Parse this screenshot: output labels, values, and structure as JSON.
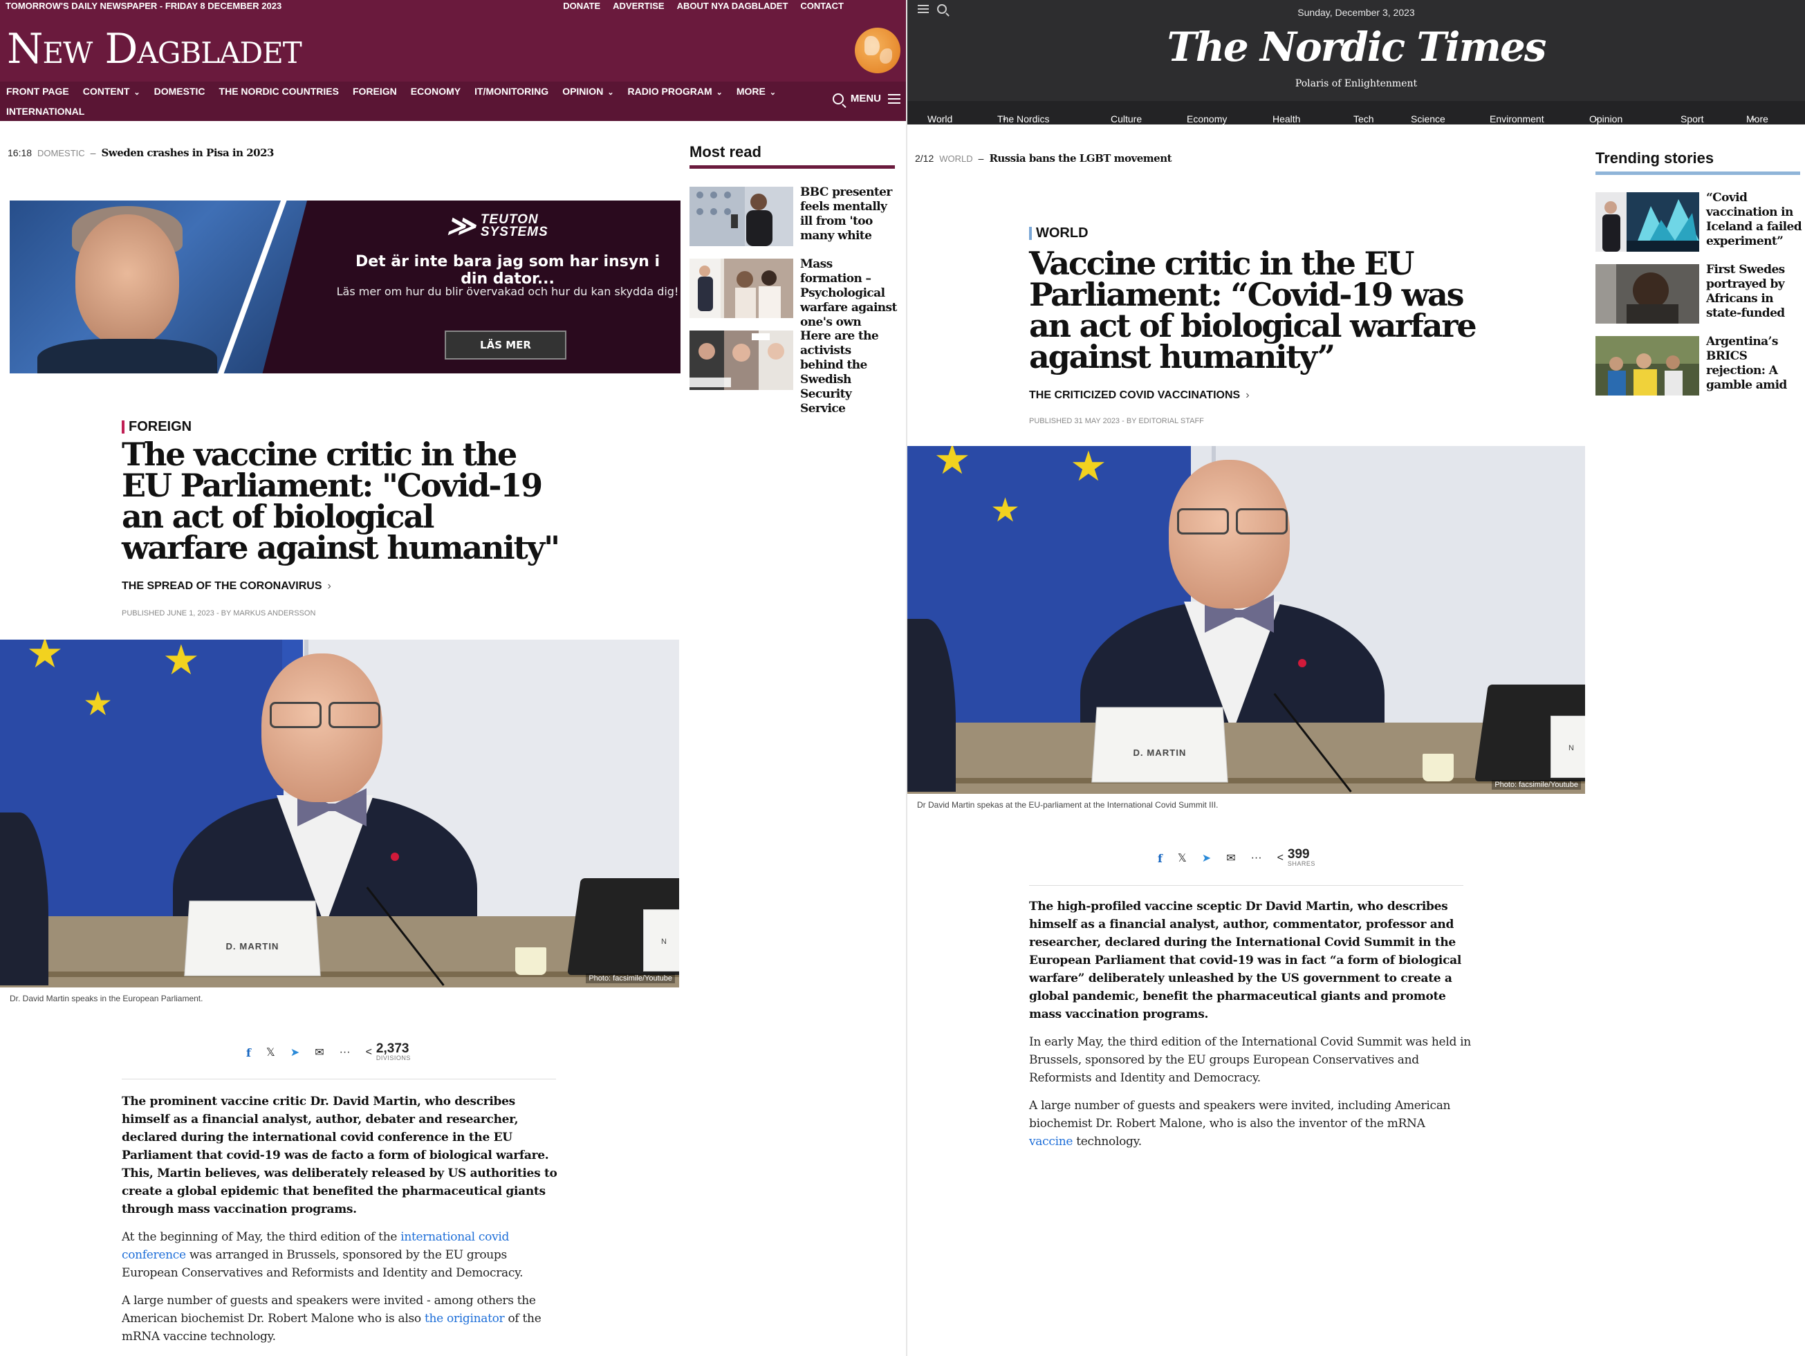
{
  "left": {
    "topbar": {
      "tagline": "TOMORROW'S DAILY NEWSPAPER - FRIDAY 8 DECEMBER 2023",
      "links": [
        "DONATE",
        "ADVERTISE",
        "ABOUT NYA DAGBLADET",
        "CONTACT"
      ]
    },
    "logo": "New Dagbladet",
    "nav": {
      "items": [
        {
          "label": "FRONT PAGE",
          "dropdown": false
        },
        {
          "label": "CONTENT",
          "dropdown": true
        },
        {
          "label": "DOMESTIC",
          "dropdown": false
        },
        {
          "label": "THE NORDIC COUNTRIES",
          "dropdown": false
        },
        {
          "label": "FOREIGN",
          "dropdown": false
        },
        {
          "label": "ECONOMY",
          "dropdown": false
        },
        {
          "label": "IT/MONITORING",
          "dropdown": false
        },
        {
          "label": "OPINION",
          "dropdown": true
        },
        {
          "label": "RADIO PROGRAM",
          "dropdown": true
        },
        {
          "label": "MORE",
          "dropdown": true
        }
      ],
      "second_row": "INTERNATIONAL",
      "menu_label": "MENU"
    },
    "ticker": {
      "time": "16:18",
      "category": "DOMESTIC",
      "dash": "–",
      "title": "Sweden crashes in Pisa in 2023"
    },
    "ad": {
      "brand_mark": "≫",
      "brand_line1": "TEUTON",
      "brand_line2": "SYSTEMS",
      "headline": "Det är inte bara jag som har insyn i din dator...",
      "sub": "Läs mer om hur du blir övervakad och hur du kan skydda dig!",
      "button": "LÄS MER"
    },
    "most_read": {
      "heading": "Most read",
      "items": [
        {
          "text": "BBC presenter feels mentally ill from 'too many white"
        },
        {
          "text": "Mass formation – Psychological warfare against one's own"
        },
        {
          "text": "Here are the activists behind the Swedish Security Service"
        }
      ]
    },
    "article": {
      "kicker": "FOREIGN",
      "title": "The vaccine critic in the EU Parliament: \"Covid-19 an act of biological warfare against humanity\"",
      "topic": "THE SPREAD OF THE CORONAVIRUS",
      "meta": "PUBLISHED JUNE 1, 2023 - BY MARKUS ANDERSSON",
      "photo_credit": "Photo: facsimile/Youtube",
      "nameplate": "D. MARTIN",
      "caption": "Dr. David Martin speaks in the European Parliament.",
      "share_count": "2,373",
      "share_label": "DIVISIONS",
      "lead": "The prominent vaccine critic Dr. David Martin, who describes himself as a financial analyst, author, debater and researcher, declared during the international covid conference in the EU Parliament that covid-19 was de facto a form of biological warfare. This, Martin believes, was deliberately released by US authorities to create a global epidemic that benefited the pharmaceutical giants through mass vaccination programs.",
      "p2_before": "At the beginning of May, the third edition of the ",
      "p2_link": "international covid conference",
      "p2_after": " was arranged in Brussels, sponsored by the EU groups European Conservatives and Reformists and Identity and Democracy.",
      "p3_before": "A large number of guests and speakers were invited - among others the American biochemist Dr. Robert Malone who is also ",
      "p3_link": "the originator",
      "p3_after": " of the mRNA vaccine technology."
    }
  },
  "right": {
    "date": "Sunday, December 3, 2023",
    "logo": "The Nordic Times",
    "tagline": "Polaris of Enlightenment",
    "nav": [
      {
        "label": "World",
        "dropdown": false
      },
      {
        "label": "The Nordics",
        "dropdown": true
      },
      {
        "label": "Culture",
        "dropdown": false
      },
      {
        "label": "Economy",
        "dropdown": false
      },
      {
        "label": "Health",
        "dropdown": false
      },
      {
        "label": "Tech",
        "dropdown": false
      },
      {
        "label": "Science",
        "dropdown": false
      },
      {
        "label": "Environment",
        "dropdown": false
      },
      {
        "label": "Opinion",
        "dropdown": true
      },
      {
        "label": "Sport",
        "dropdown": false
      },
      {
        "label": "More",
        "dropdown": true
      }
    ],
    "ticker": {
      "time": "2/12",
      "category": "WORLD",
      "dash": "–",
      "title": "Russia bans the LGBT movement"
    },
    "trending": {
      "heading": "Trending stories",
      "items": [
        {
          "text": "“Covid vaccination in Iceland a failed experiment”"
        },
        {
          "text": "First Swedes portrayed by Africans in state-funded"
        },
        {
          "text": "Argentina’s BRICS rejection: A gamble amid"
        }
      ]
    },
    "article": {
      "kicker": "WORLD",
      "title": "Vaccine critic in the EU Parliament: “Covid-19 was an act of biological warfare against humanity”",
      "topic": "THE CRITICIZED COVID VACCINATIONS",
      "meta": "PUBLISHED 31 MAY 2023 - BY EDITORIAL STAFF",
      "photo_credit": "Photo: facsimile/Youtube",
      "nameplate": "D. MARTIN",
      "caption": "Dr David Martin spekas at the EU-parliament at the International Covid Summit III.",
      "share_count": "399",
      "share_label": "SHARES",
      "lead": "The high-profiled vaccine sceptic Dr David Martin, who describes himself as a financial analyst, author, commentator, professor and researcher, declared during the International Covid Summit in the European Parliament that covid-19 was in fact “a form of biological warfare” deliberately unleashed by the US government to create a global pandemic, benefit the pharmaceutical giants and promote mass vaccination programs.",
      "p2": "In early May, the third edition of the International Covid Summit was held in Brussels, sponsored by the EU groups European Conservatives and Reformists and Identity and Democracy.",
      "p3_before": "A large number of guests and speakers were invited, including American biochemist Dr. Robert Malone, who is also the inventor of the mRNA ",
      "p3_link": "vaccine",
      "p3_after": " technology."
    }
  },
  "share_icons": [
    "facebook-icon",
    "x-icon",
    "telegram-icon",
    "email-icon",
    "more-icon",
    "share-icon"
  ],
  "colors": {
    "left_brand": "#6a1a3d",
    "left_nav": "#5a1534",
    "right_header": "#2d2d2f",
    "link": "#1d6ed8",
    "left_kicker_bar": "#c02055",
    "right_kicker_bar": "#7aa7d6"
  }
}
